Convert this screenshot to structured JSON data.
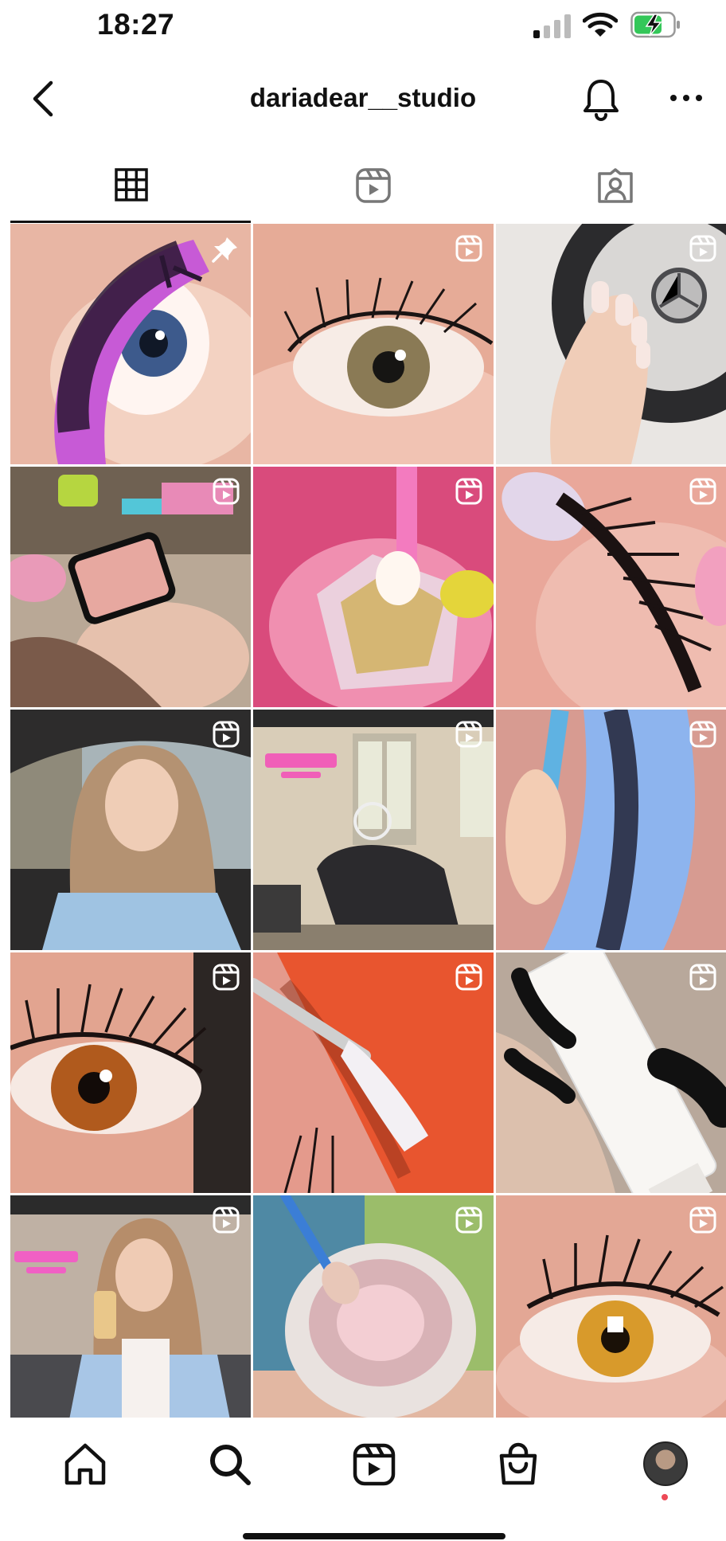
{
  "status_bar": {
    "time": "18:27"
  },
  "header": {
    "title": "dariadear__studio"
  },
  "tabs": [
    {
      "name": "grid",
      "active": true
    },
    {
      "name": "reels",
      "active": false
    },
    {
      "name": "tagged",
      "active": false
    }
  ],
  "grid": {
    "posts": [
      {
        "id": "lash-lift-pink-shield",
        "type": "pinned"
      },
      {
        "id": "eye-closeup-green",
        "type": "reel"
      },
      {
        "id": "manicure-steering-wheel",
        "type": "reel"
      },
      {
        "id": "client-with-phone",
        "type": "reel"
      },
      {
        "id": "crystal-glue-cup",
        "type": "reel"
      },
      {
        "id": "lash-brush-pink",
        "type": "reel"
      },
      {
        "id": "woman-in-car",
        "type": "reel"
      },
      {
        "id": "studio-interior",
        "type": "reel"
      },
      {
        "id": "blue-brush-lashes",
        "type": "reel"
      },
      {
        "id": "brown-eye-lashes",
        "type": "reel"
      },
      {
        "id": "red-shield-gel",
        "type": "reel"
      },
      {
        "id": "k18-product",
        "type": "reel"
      },
      {
        "id": "selfie-studio",
        "type": "reel"
      },
      {
        "id": "glass-mixing-cup",
        "type": "reel"
      },
      {
        "id": "amber-eye-lashes",
        "type": "reel"
      }
    ]
  },
  "bottom_nav": {
    "items": [
      "home-icon",
      "search-icon",
      "reels-icon",
      "shop-icon",
      "profile-avatar"
    ],
    "notification_dot_color": "#ed4956"
  }
}
